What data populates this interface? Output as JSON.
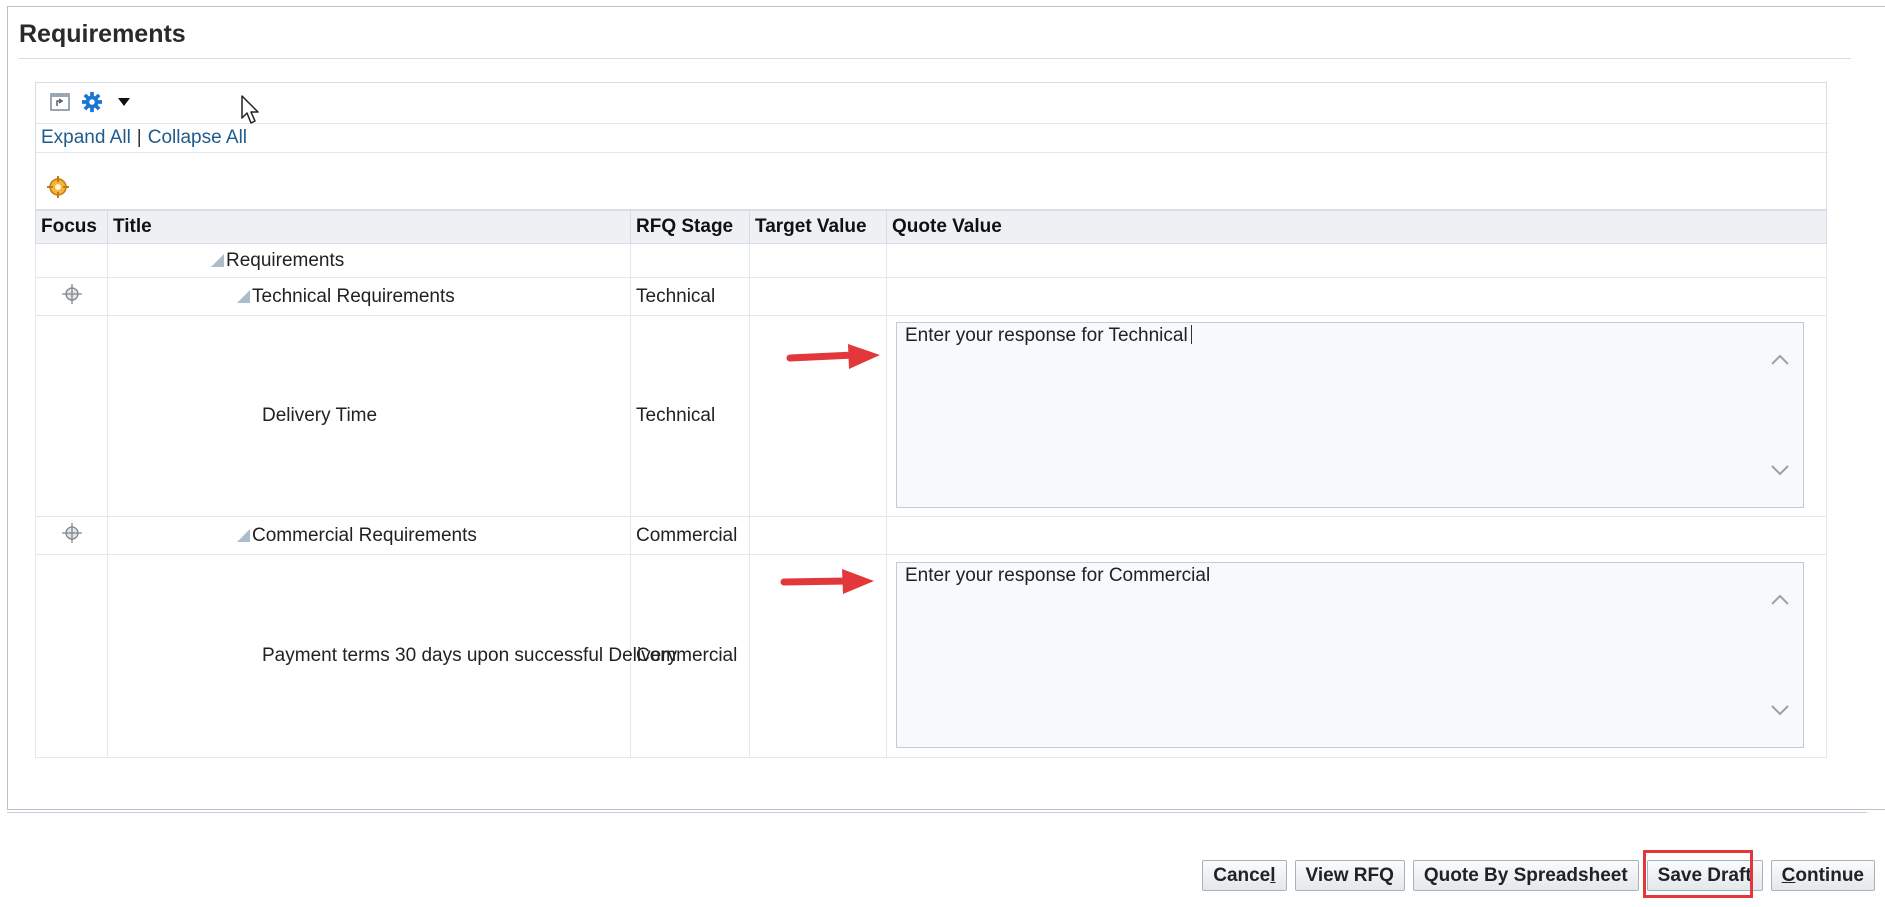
{
  "section": {
    "title": "Requirements"
  },
  "toolbar": {
    "detach_icon": "detach-icon",
    "settings_icon": "gear-icon",
    "dropdown_icon": "caret-down-icon"
  },
  "links": {
    "expand_all": "Expand All",
    "separator": "|",
    "collapse_all": "Collapse All"
  },
  "table": {
    "headers": [
      "Focus",
      "Title",
      "RFQ Stage",
      "Target Value",
      "Quote Value"
    ],
    "rows": [
      {
        "title": "Requirements",
        "stage": "",
        "target": "",
        "quote": ""
      },
      {
        "title": "Technical Requirements",
        "stage": "Technical",
        "target": "",
        "quote": ""
      },
      {
        "title": "Delivery Time",
        "stage": "Technical",
        "target": "",
        "quote": "Enter your response for Technical"
      },
      {
        "title": "Commercial Requirements",
        "stage": "Commercial",
        "target": "",
        "quote": ""
      },
      {
        "title": "Payment terms 30 days upon successful Delivery",
        "stage": "Commercial",
        "target": "",
        "quote": "Enter your response for Commercial"
      }
    ]
  },
  "buttons": {
    "cancel_pre": "Cance",
    "cancel_key": "l",
    "view_rfq": "View RFQ",
    "quote_by_spreadsheet": "Quote By Spreadsheet",
    "save_draft": "Save Draft",
    "continue_key": "C",
    "continue_post": "ontinue"
  },
  "colors": {
    "annotation_arrow": "#e2383b",
    "highlight_box": "#e2383b",
    "link": "#1f5b8b",
    "header_bg": "#edf1f4"
  }
}
